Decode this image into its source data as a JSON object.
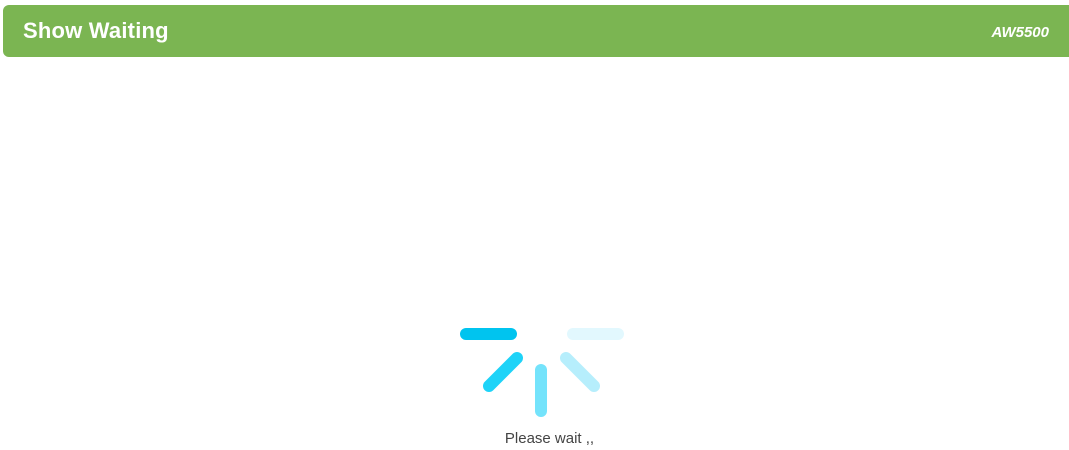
{
  "header": {
    "title": "Show Waiting",
    "model": "AW5500",
    "background_color": "#7bb552"
  },
  "spinner": {
    "icon": "loading-spinner-icon",
    "colors": {
      "top_left_bar": "#00c4ef",
      "diagonal_left": "#1ed3f8",
      "vertical_center": "#74e3fb",
      "diagonal_right": "#b6eefc",
      "top_right_bar": "#e2f8fe"
    }
  },
  "status": {
    "message": "Please wait ,,"
  }
}
